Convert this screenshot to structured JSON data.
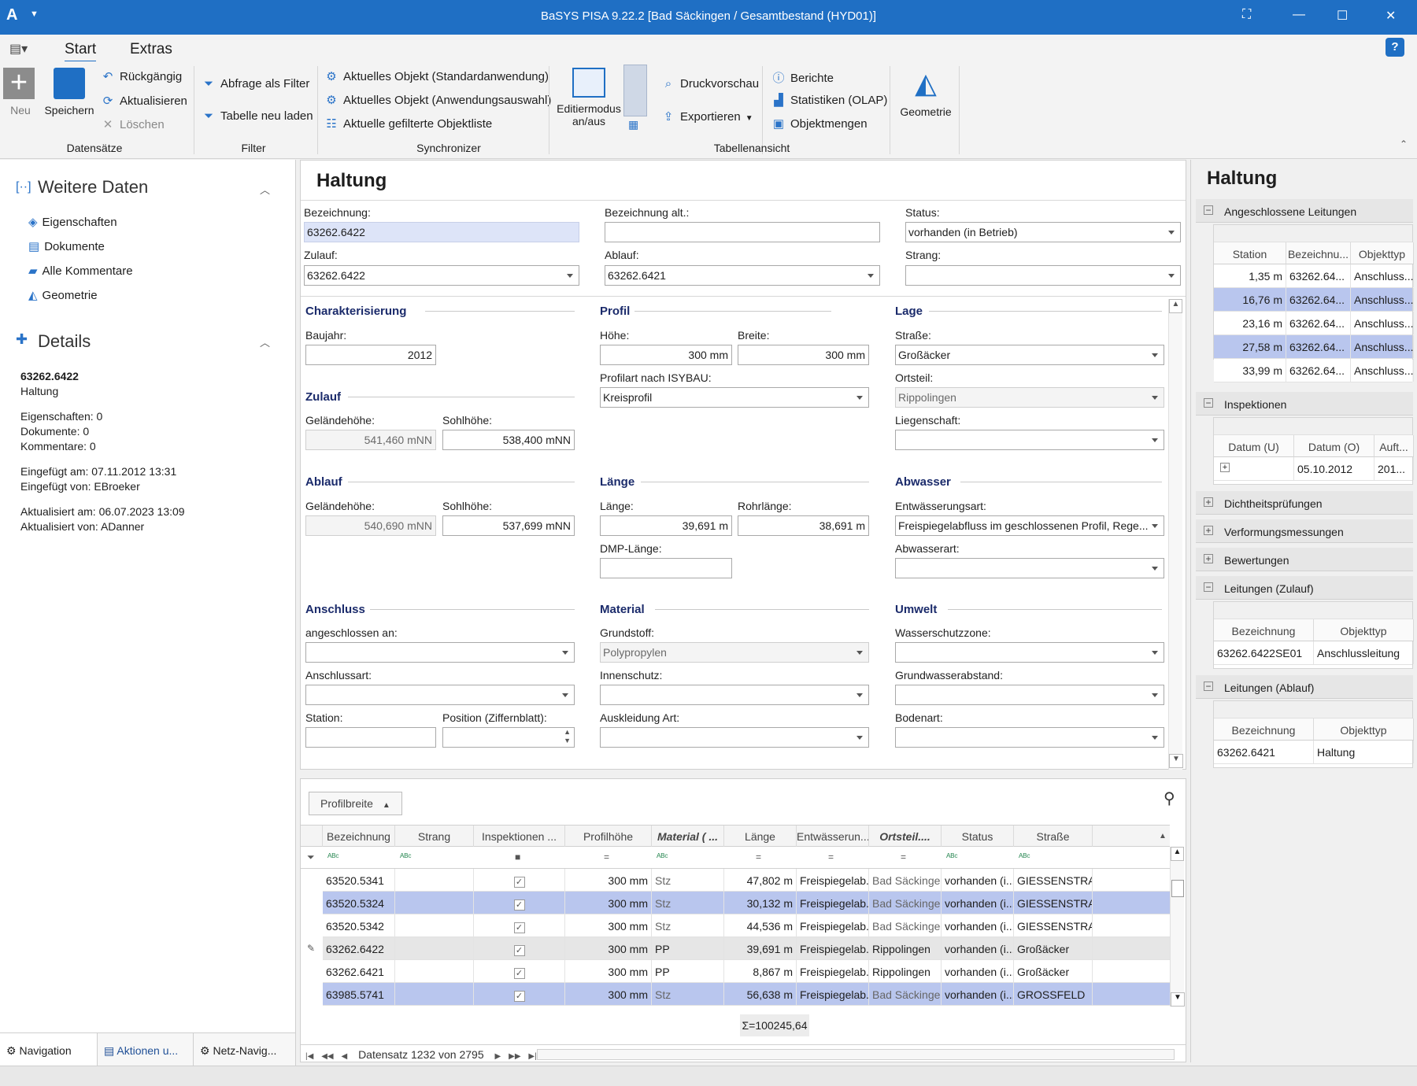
{
  "titlebar": {
    "title": "BaSYS PISA 9.22.2  [Bad Säckingen / Gesamtbestand (HYD01)]",
    "app_icon": "A"
  },
  "menu": {
    "tab_start": "Start",
    "tab_extras": "Extras",
    "help": "?"
  },
  "ribbon": {
    "neu": "Neu",
    "speichern": "Speichern",
    "rueckgaengig": "Rückgängig",
    "aktualisieren": "Aktualisieren",
    "loeschen": "Löschen",
    "grp_datensaetze": "Datensätze",
    "abfrage_filter": "Abfrage als Filter",
    "tabelle_neu": "Tabelle neu laden",
    "grp_filter": "Filter",
    "sync1": "Aktuelles Objekt (Standardanwendung)",
    "sync2": "Aktuelles Objekt (Anwendungsauswahl)",
    "sync3": "Aktuelle gefilterte Objektliste",
    "grp_sync": "Synchronizer",
    "editiermodus1": "Editiermodus",
    "editiermodus2": "an/aus",
    "druckvorschau": "Druckvorschau",
    "exportieren": "Exportieren",
    "berichte": "Berichte",
    "statistiken": "Statistiken (OLAP)",
    "objektmengen": "Objektmengen",
    "grp_tabellenansicht": "Tabellenansicht",
    "geometrie": "Geometrie"
  },
  "left": {
    "weitere_daten": "Weitere Daten",
    "nav": [
      "Eigenschaften",
      "Dokumente",
      "Alle Kommentare",
      "Geometrie"
    ],
    "details_title": "Details",
    "obj_id": "63262.6422",
    "obj_type": "Haltung",
    "eigenschaften": "Eigenschaften: 0",
    "dokumente": "Dokumente: 0",
    "kommentare": "Kommentare: 0",
    "eingefuegt_am": "Eingefügt am: 07.11.2012 13:31",
    "eingefuegt_von": "Eingefügt von: EBroeker",
    "aktualisiert_am": "Aktualisiert am: 06.07.2023 13:09",
    "aktualisiert_von": "Aktualisiert von: ADanner",
    "tabs": [
      "Navigation",
      "Aktionen u...",
      "Netz-Navig..."
    ]
  },
  "form": {
    "title": "Haltung",
    "bezeichnung_lbl": "Bezeichnung:",
    "bezeichnung": "63262.6422",
    "bez_alt_lbl": "Bezeichnung alt.:",
    "bez_alt": "",
    "status_lbl": "Status:",
    "status": "vorhanden (in Betrieb)",
    "zulauf_lbl": "Zulauf:",
    "zulauf": "63262.6422",
    "ablauf_lbl": "Ablauf:",
    "ablauf": "63262.6421",
    "strang_lbl": "Strang:",
    "strang": "",
    "charakterisierung": "Charakterisierung",
    "baujahr_lbl": "Baujahr:",
    "baujahr": "2012",
    "zulauf_grp": "Zulauf",
    "gel_lbl": "Geländehöhe:",
    "sohl_lbl": "Sohlhöhe:",
    "zu_gel": "541,460 mNN",
    "zu_sohl": "538,400 mNN",
    "ablauf_grp": "Ablauf",
    "ab_gel": "540,690 mNN",
    "ab_sohl": "537,699 mNN",
    "anschluss": "Anschluss",
    "angeschlossen_lbl": "angeschlossen an:",
    "anschlussart_lbl": "Anschlussart:",
    "station_lbl": "Station:",
    "position_lbl": "Position (Ziffernblatt):",
    "profil": "Profil",
    "hoehe_lbl": "Höhe:",
    "hoehe": "300 mm",
    "breite_lbl": "Breite:",
    "breite": "300 mm",
    "profilart_lbl": "Profilart nach ISYBAU:",
    "profilart": "Kreisprofil",
    "laenge_grp": "Länge",
    "laenge_lbl": "Länge:",
    "laenge": "39,691 m",
    "rohr_lbl": "Rohrlänge:",
    "rohr": "38,691 m",
    "dmp_lbl": "DMP-Länge:",
    "material": "Material",
    "grundstoff_lbl": "Grundstoff:",
    "grundstoff": "Polypropylen",
    "innenschutz_lbl": "Innenschutz:",
    "auskleidung_lbl": "Auskleidung Art:",
    "lage": "Lage",
    "strasse_lbl": "Straße:",
    "strasse": "Großäcker",
    "ortsteil_lbl": "Ortsteil:",
    "ortsteil": "Rippolingen",
    "liegenschaft_lbl": "Liegenschaft:",
    "abwasser": "Abwasser",
    "entw_lbl": "Entwässerungsart:",
    "entw": "Freispiegelabfluss im geschlossenen Profil, Rege...",
    "abwasserart_lbl": "Abwasserart:",
    "umwelt": "Umwelt",
    "wsz_lbl": "Wasserschutzzone:",
    "gwa_lbl": "Grundwasserabstand:",
    "bodenart_lbl": "Bodenart:"
  },
  "grid": {
    "groupby": "Profilbreite",
    "columns": [
      "Bezeichnung",
      "Strang",
      "Inspektionen ...",
      "Profilhöhe",
      "Material ( ...",
      "Länge",
      "Entwässerun...",
      "Ortsteil....",
      "Status",
      "Straße"
    ],
    "rows": [
      [
        "63520.5341",
        "",
        "✓",
        "300 mm",
        "Stz",
        "47,802 m",
        "Freispiegelab...",
        "Bad Säckingen",
        "vorhanden (i...",
        "GIESSENSTRAS..."
      ],
      [
        "63520.5324",
        "",
        "✓",
        "300 mm",
        "Stz",
        "30,132 m",
        "Freispiegelab...",
        "Bad Säckingen",
        "vorhanden (i...",
        "GIESSENSTRAS..."
      ],
      [
        "63520.5342",
        "",
        "✓",
        "300 mm",
        "Stz",
        "44,536 m",
        "Freispiegelab...",
        "Bad Säckingen",
        "vorhanden (i...",
        "GIESSENSTRAS..."
      ],
      [
        "63262.6422",
        "",
        "✓",
        "300 mm",
        "PP",
        "39,691 m",
        "Freispiegelab...",
        "Rippolingen",
        "vorhanden (i...",
        "Großäcker"
      ],
      [
        "63262.6421",
        "",
        "✓",
        "300 mm",
        "PP",
        "8,867 m",
        "Freispiegelab...",
        "Rippolingen",
        "vorhanden (i...",
        "Großäcker"
      ],
      [
        "63985.5741",
        "",
        "✓",
        "300 mm",
        "Stz",
        "56,638 m",
        "Freispiegelab...",
        "Bad Säckingen",
        "vorhanden (i...",
        "GROSSFELD"
      ]
    ],
    "sum": "Σ=100245,64",
    "navigator": "Datensatz 1232 von 2795"
  },
  "right": {
    "title": "Haltung",
    "angeschlossene": "Angeschlossene Leitungen",
    "ang_cols": [
      "Station",
      "Bezeichnu...",
      "Objekttyp"
    ],
    "ang_rows": [
      [
        "1,35 m",
        "63262.64...",
        "Anschluss..."
      ],
      [
        "16,76 m",
        "63262.64...",
        "Anschluss..."
      ],
      [
        "23,16 m",
        "63262.64...",
        "Anschluss..."
      ],
      [
        "27,58 m",
        "63262.64...",
        "Anschluss..."
      ],
      [
        "33,99 m",
        "63262.64...",
        "Anschluss..."
      ]
    ],
    "inspektionen": "Inspektionen",
    "insp_cols": [
      "Datum (U)",
      "Datum (O)",
      "Auft..."
    ],
    "insp_rows": [
      [
        "",
        "05.10.2012",
        "201..."
      ]
    ],
    "dichtheit": "Dichtheitsprüfungen",
    "verformung": "Verformungsmessungen",
    "bewertungen": "Bewertungen",
    "zulauf": "Leitungen (Zulauf)",
    "zu_cols": [
      "Bezeichnung",
      "Objekttyp"
    ],
    "zu_rows": [
      [
        "63262.6422SE01",
        "Anschlussleitung"
      ]
    ],
    "ablauf": "Leitungen (Ablauf)",
    "ab_cols": [
      "Bezeichnung",
      "Objekttyp"
    ],
    "ab_rows": [
      [
        "63262.6421",
        "Haltung"
      ]
    ]
  },
  "colors": {
    "accent": "#1f6fc4",
    "selected_row": "#b9c6ee",
    "group_title": "#1b2b6b"
  }
}
